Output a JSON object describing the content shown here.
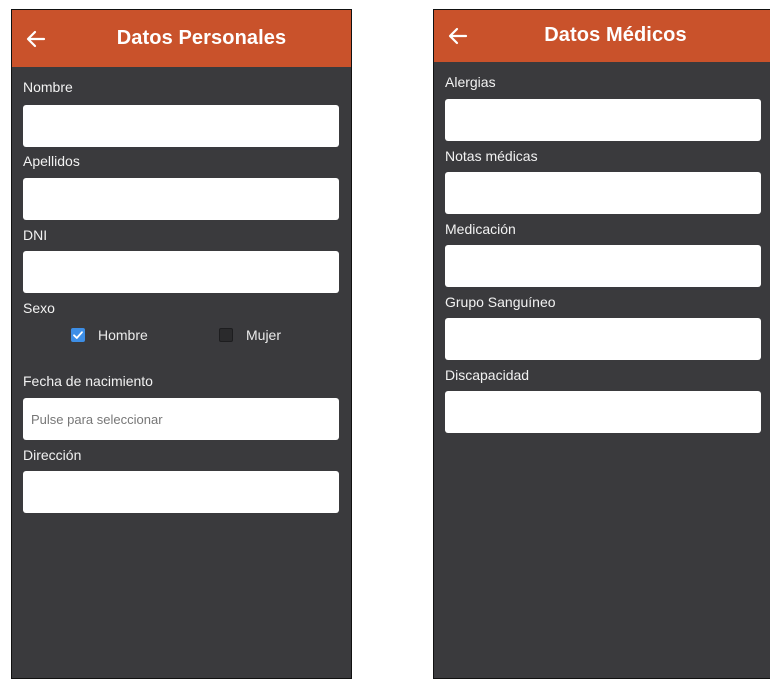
{
  "personal": {
    "title": "Datos Personales",
    "fields": {
      "nombre": {
        "label": "Nombre",
        "value": ""
      },
      "apellidos": {
        "label": "Apellidos",
        "value": ""
      },
      "dni": {
        "label": "DNI",
        "value": ""
      },
      "fecha": {
        "label": "Fecha de nacimiento",
        "placeholder": "Pulse para seleccionar"
      },
      "direccion": {
        "label": "Dirección",
        "value": ""
      }
    },
    "sexo": {
      "label": "Sexo",
      "options": [
        {
          "label": "Hombre",
          "checked": true
        },
        {
          "label": "Mujer",
          "checked": false
        }
      ]
    }
  },
  "medical": {
    "title": "Datos Médicos",
    "fields": {
      "alergias": {
        "label": "Alergias",
        "value": ""
      },
      "notas": {
        "label": "Notas médicas",
        "value": ""
      },
      "medicacion": {
        "label": "Medicación",
        "value": ""
      },
      "grupo": {
        "label": "Grupo Sanguíneo",
        "value": ""
      },
      "discapacidad": {
        "label": "Discapacidad",
        "value": ""
      }
    }
  },
  "colors": {
    "appbar": "#c9522b",
    "background": "#3a3a3d",
    "checkbox_checked": "#3d8ee6"
  },
  "icons": {
    "back": "arrow-left-icon",
    "check": "checkmark-icon"
  }
}
